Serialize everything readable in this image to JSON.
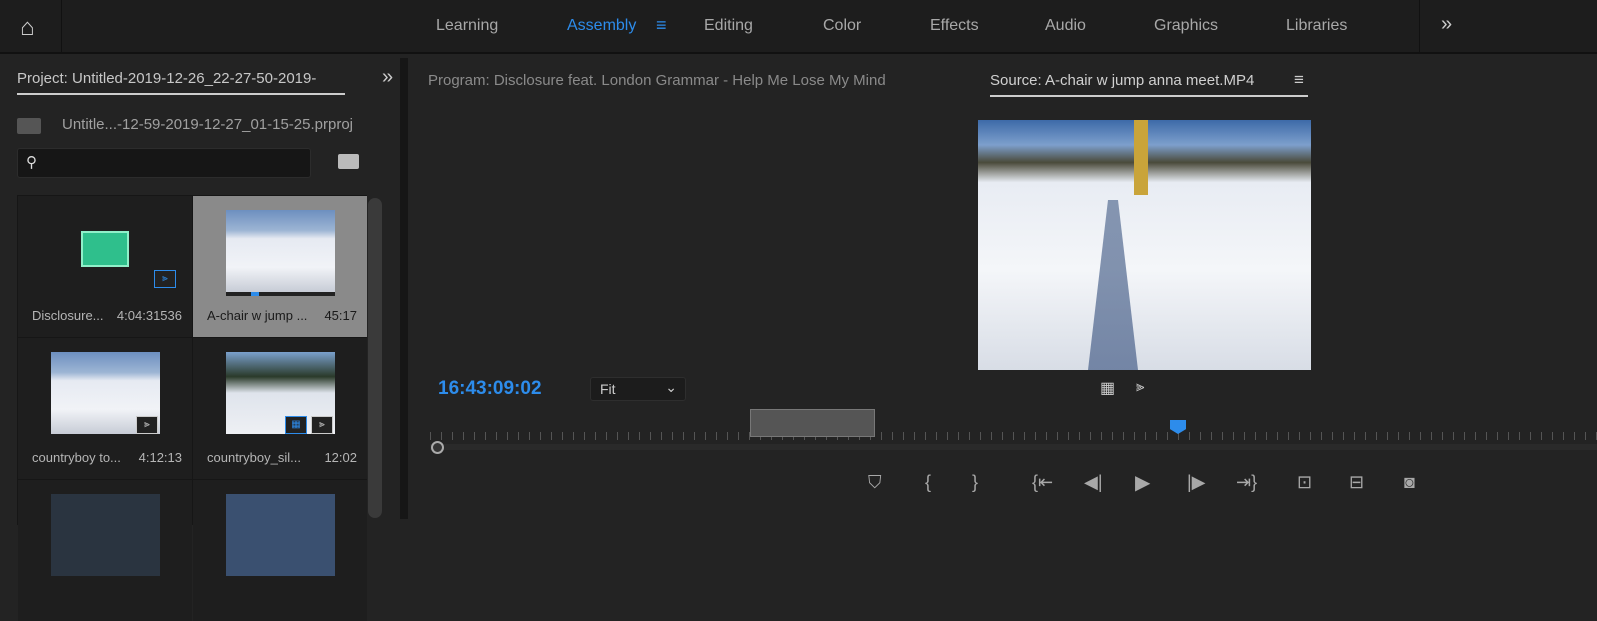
{
  "topbar": {
    "workspaces": [
      "Learning",
      "Assembly",
      "Editing",
      "Color",
      "Effects",
      "Audio",
      "Graphics",
      "Libraries"
    ],
    "active": "Assembly",
    "accent": "#2d8ceb"
  },
  "project": {
    "tab": "Project: Untitled-2019-12-26_22-27-50-2019-",
    "file": "Untitle...-12-59-2019-12-27_01-15-25.prproj",
    "search_placeholder": "",
    "items": [
      {
        "name": "Disclosure...",
        "duration": "4:04:31536"
      },
      {
        "name": "A-chair w jump ...",
        "duration": "45:17"
      },
      {
        "name": "countryboy to...",
        "duration": "4:12:13"
      },
      {
        "name": "countryboy_sil...",
        "duration": "12:02"
      }
    ]
  },
  "monitor": {
    "program_tab": "Program: Disclosure feat. London Grammar - Help Me Lose My Mind",
    "source_tab": "Source: A-chair w jump anna meet.MP4",
    "timecode": "16:43:09:02",
    "zoom": "Fit"
  }
}
